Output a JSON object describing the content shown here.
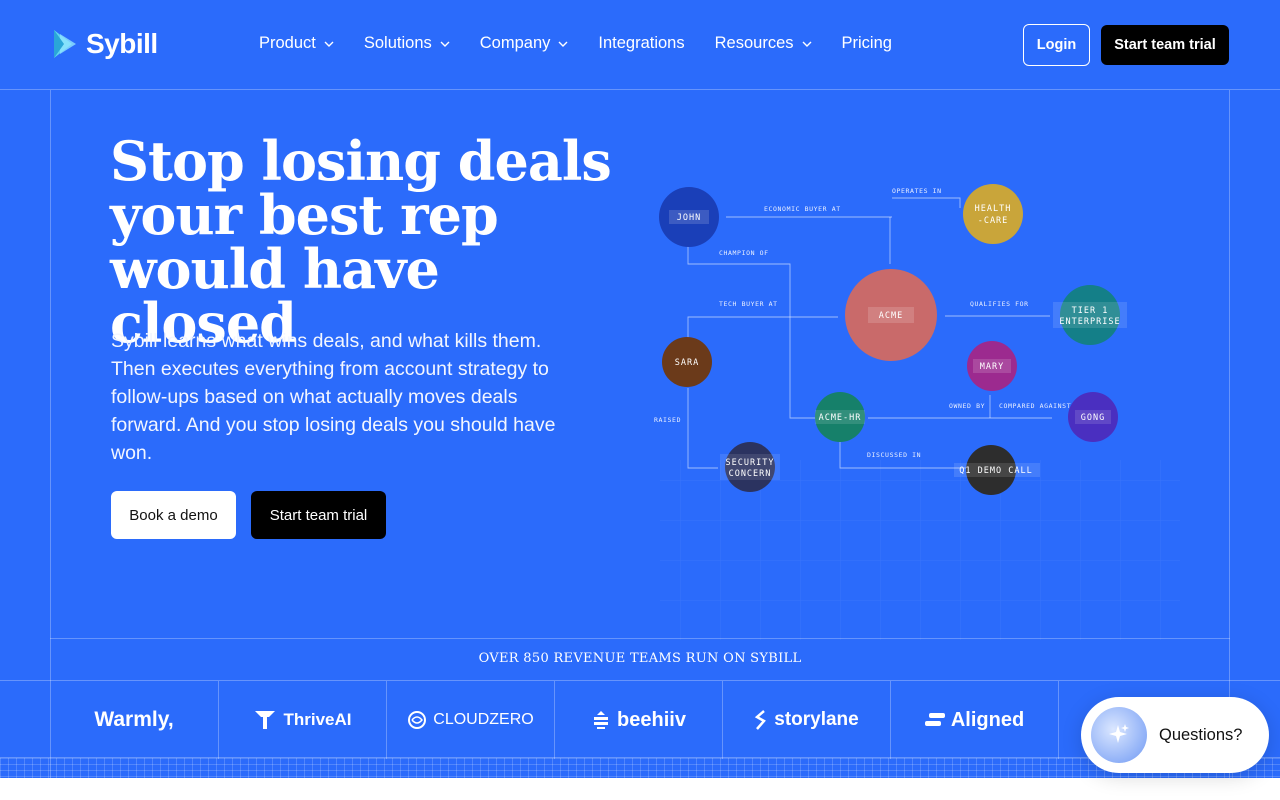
{
  "brand": {
    "name": "Sybill"
  },
  "nav": {
    "items": [
      {
        "label": "Product",
        "has_dropdown": true
      },
      {
        "label": "Solutions",
        "has_dropdown": true
      },
      {
        "label": "Company",
        "has_dropdown": true
      },
      {
        "label": "Integrations",
        "has_dropdown": false
      },
      {
        "label": "Resources",
        "has_dropdown": true
      },
      {
        "label": "Pricing",
        "has_dropdown": false
      }
    ],
    "login_label": "Login",
    "trial_label": "Start team trial"
  },
  "hero": {
    "headline_lines": [
      "Stop losing deals",
      "your best rep",
      "would have closed"
    ],
    "subtext": "Sybill learns what wins deals, and what kills them. Then executes everything from account strategy to follow-ups based on what actually moves deals forward. And you stop losing deals you should have won.",
    "demo_label": "Book a demo",
    "trial_label": "Start team trial"
  },
  "graph": {
    "nodes": [
      {
        "id": "john",
        "label": "JOHN",
        "color": "#1a3fb8"
      },
      {
        "id": "healthcare",
        "label_lines": [
          "HEALTH",
          "-CARE"
        ],
        "color": "#c9a53a"
      },
      {
        "id": "acme",
        "label": "ACME",
        "color": "#c96a6a"
      },
      {
        "id": "tier1",
        "label_lines": [
          "TIER 1",
          "ENTERPRISE"
        ],
        "color": "#147f88"
      },
      {
        "id": "sara",
        "label": "SARA",
        "color": "#6b3a1a"
      },
      {
        "id": "mary",
        "label": "MARY",
        "color": "#9c2a8f"
      },
      {
        "id": "acmehr",
        "label": "ACME-HR",
        "color": "#16806a"
      },
      {
        "id": "gong",
        "label": "GONG",
        "color": "#4a2fc0"
      },
      {
        "id": "security",
        "label_lines": [
          "SECURITY",
          "CONCERN"
        ],
        "color": "#2b3360"
      },
      {
        "id": "demo",
        "label": "Q1 DEMO CALL",
        "color": "#2d2d2d"
      }
    ],
    "edge_labels": [
      "ECONOMIC BUYER AT",
      "OPERATES IN",
      "CHAMPION OF",
      "TECH BUYER AT",
      "QUALIFIES FOR",
      "RAISED",
      "OWNED BY",
      "COMPARED AGAINST",
      "DISCUSSED IN"
    ]
  },
  "social_proof": {
    "headline": "OVER 850 REVENUE TEAMS RUN ON SYBILL",
    "logos": [
      "Warmly,",
      "ThriveAI",
      "CLOUDZERO",
      "beehiiv",
      "storylane",
      "Aligned"
    ]
  },
  "chat_widget": {
    "label": "Questions?"
  }
}
